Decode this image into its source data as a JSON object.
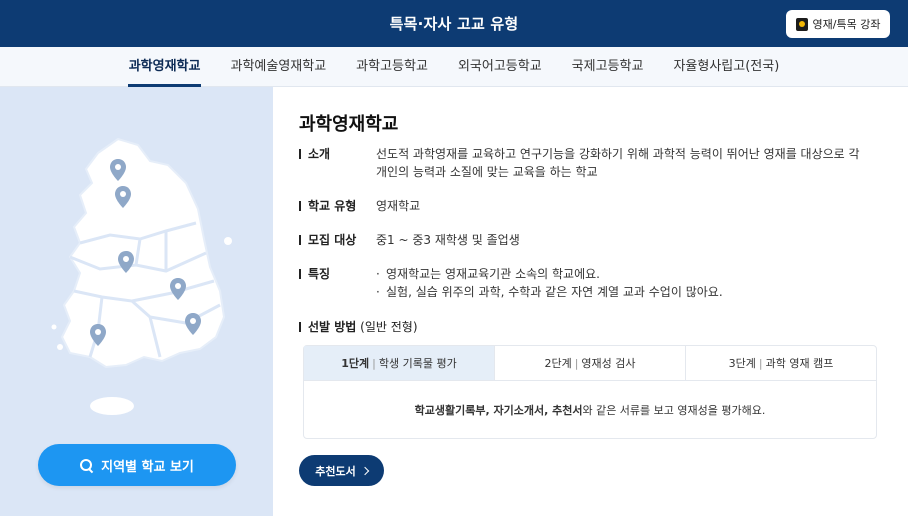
{
  "header": {
    "title": "특목·자사 고교 유형",
    "badge_button_label": "영재/특목 강좌"
  },
  "tabs": [
    {
      "label": "과학영재학교",
      "active": true
    },
    {
      "label": "과학예술영재학교",
      "active": false
    },
    {
      "label": "과학고등학교",
      "active": false
    },
    {
      "label": "외국어고등학교",
      "active": false
    },
    {
      "label": "국제고등학교",
      "active": false
    },
    {
      "label": "자율형사립고(전국)",
      "active": false
    }
  ],
  "left": {
    "region_button_label": "지역별 학교 보기",
    "map_pin_count": 6
  },
  "content": {
    "title": "과학영재학교",
    "intro_label": "소개",
    "intro_value": "선도적 과학영재를 교육하고 연구기능을 강화하기 위해 과학적 능력이 뛰어난 영재를 대상으로 각 개인의 능력과 소질에 맞는 교육을 하는 학교",
    "type_label": "학교 유형",
    "type_value": "영재학교",
    "recruit_label": "모집 대상",
    "recruit_value": "중1 ~ 중3 재학생 및 졸업생",
    "feature_label": "특징",
    "features": [
      "영재학교는 영재교육기관 소속의 학교에요.",
      "실험, 실습 위주의 과학, 수학과 같은 자연 계열 교과 수업이 많아요."
    ],
    "selection_label": "선발 방법",
    "selection_sub": "(일반 전형)",
    "steps": [
      {
        "stage": "1단계",
        "name": "학생 기록물 평가",
        "active": true
      },
      {
        "stage": "2단계",
        "name": "영재성 검사",
        "active": false
      },
      {
        "stage": "3단계",
        "name": "과학 영재 캠프",
        "active": false
      }
    ],
    "step_desc": {
      "bold": "학교생활기록부, 자기소개서, 추천서",
      "rest": "와 같은 서류를 보고 영재성을 평가해요."
    },
    "book_button_label": "추천도서"
  },
  "colors": {
    "header_bg": "#0d3b73",
    "left_panel_bg": "#dbe6f6",
    "map_fill": "#ffffff",
    "pin_color": "#8fa8c8",
    "region_button": "#1d96f2",
    "active_step_bg": "#e5eef8"
  }
}
